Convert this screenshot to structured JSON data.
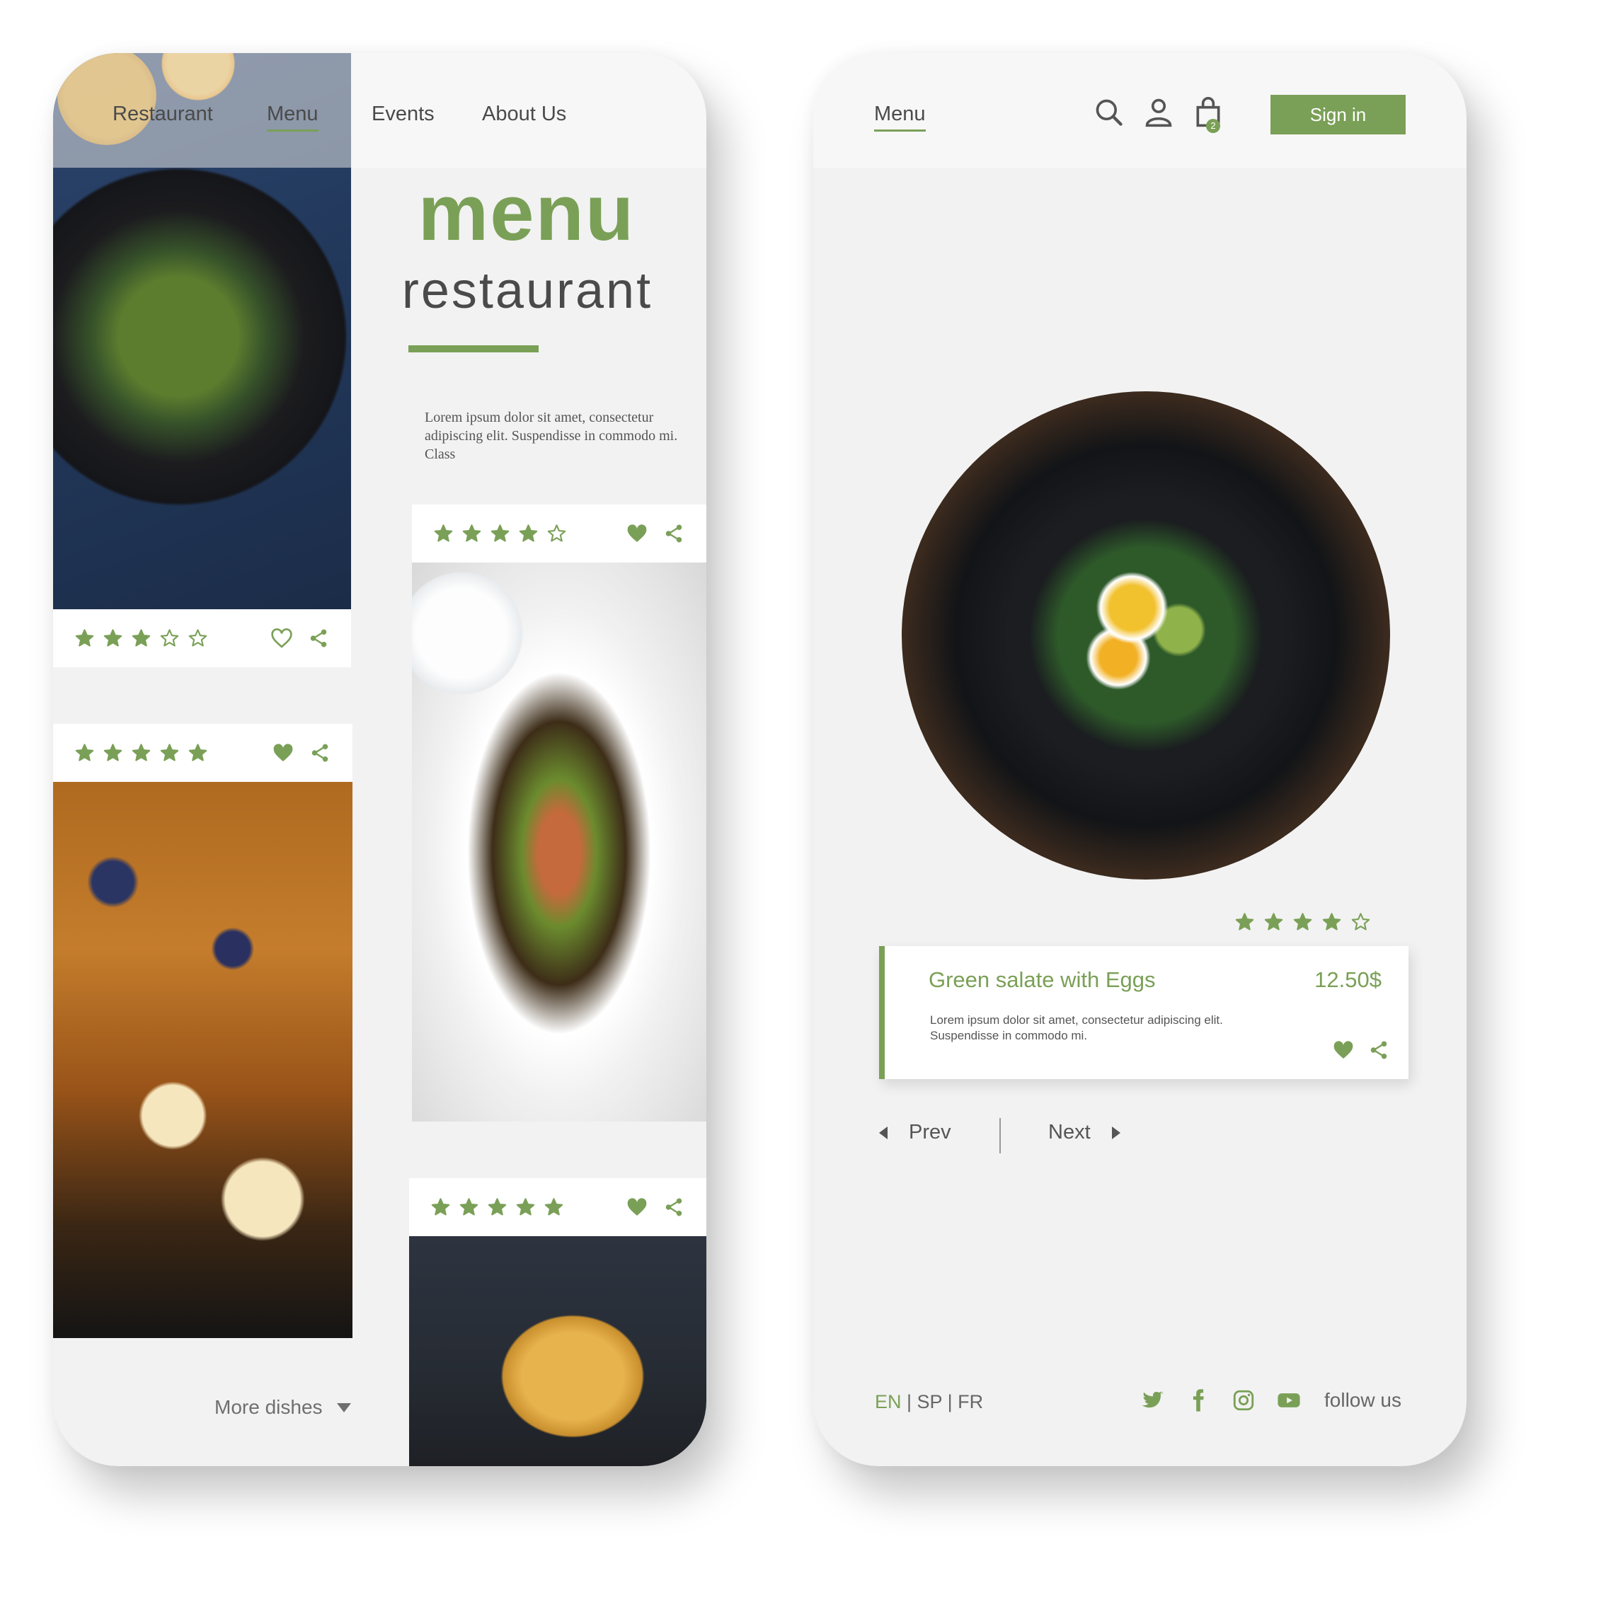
{
  "colors": {
    "accent": "#7aa057",
    "text": "#4a4a4a",
    "card": "#ffffff",
    "background": "#f2f2f2"
  },
  "left_screen": {
    "nav": {
      "items": [
        "Restaurant",
        "Menu",
        "Events",
        "About Us"
      ],
      "active": "Menu"
    },
    "hero": {
      "title": "menu",
      "subtitle": "restaurant",
      "description": "Lorem ipsum dolor sit amet, consectetur adipiscing elit. Suspendisse in commodo mi. Class"
    },
    "cards": [
      {
        "photo": "salad",
        "rating": 3,
        "max_rating": 5,
        "liked": false,
        "icons": [
          "heart-outline-icon",
          "share-icon"
        ]
      },
      {
        "photo": "salmon",
        "rating": 4,
        "max_rating": 5,
        "liked": true,
        "icons": [
          "heart-icon",
          "share-icon"
        ]
      },
      {
        "photo": "french-toast",
        "rating": 5,
        "max_rating": 5,
        "liked": true,
        "icons": [
          "heart-icon",
          "share-icon"
        ]
      },
      {
        "photo": "pancakes",
        "rating": 5,
        "max_rating": 5,
        "liked": true,
        "icons": [
          "heart-icon",
          "share-icon"
        ]
      }
    ],
    "more_dishes": "More dishes"
  },
  "right_screen": {
    "nav": {
      "menu_label": "Menu",
      "icons": [
        "search-icon",
        "user-icon",
        "shopping-bag-icon"
      ],
      "cart_count": "2",
      "sign_in": "Sign in"
    },
    "dish": {
      "rating": 4,
      "max_rating": 5,
      "name": "Green salate with Eggs",
      "price": "12.50$",
      "description": "Lorem ipsum dolor sit amet, consectetur adipiscing elit. Suspendisse in commodo mi.",
      "liked": true
    },
    "pager": {
      "prev": "Prev",
      "next": "Next"
    },
    "footer": {
      "languages": [
        "EN",
        "SP",
        "FR"
      ],
      "active_language": "EN",
      "social": [
        "twitter-icon",
        "facebook-icon",
        "instagram-icon",
        "youtube-icon"
      ],
      "follow": "follow us"
    }
  }
}
